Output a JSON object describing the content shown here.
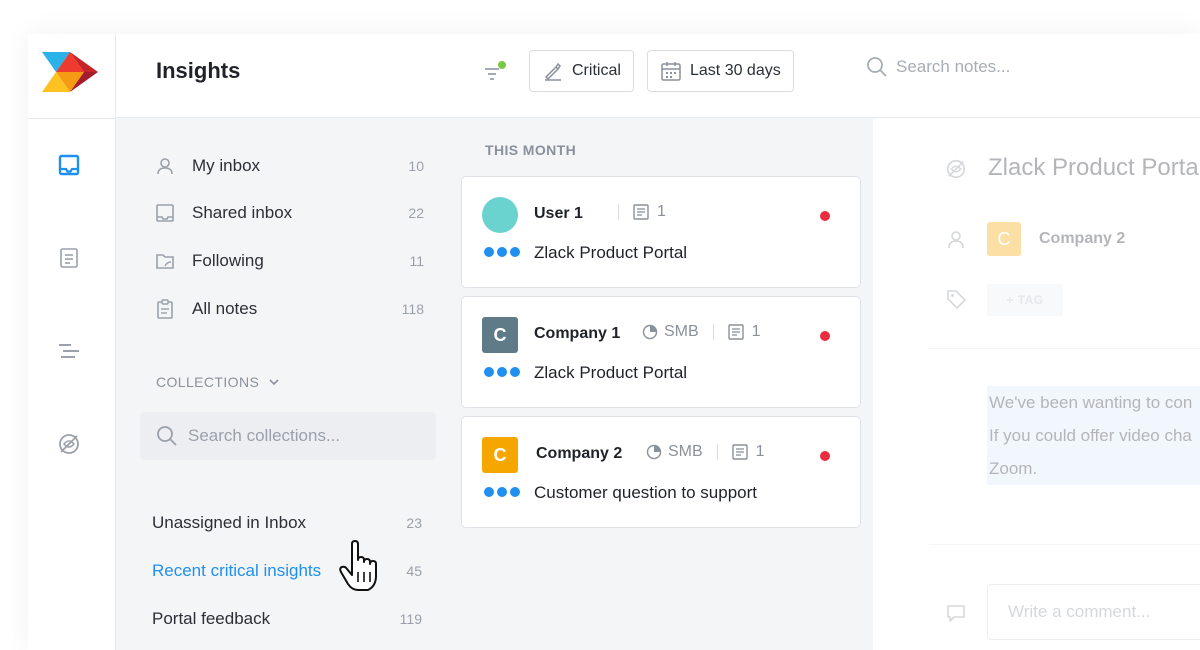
{
  "header": {
    "title": "Insights",
    "chip_critical": "Critical",
    "chip_date": "Last 30 days",
    "search_placeholder": "Search notes..."
  },
  "rail": {
    "icons": [
      "inbox-icon",
      "notes-icon",
      "roadmap-icon",
      "insights-icon"
    ],
    "active": "inbox-icon",
    "accent": "#1f8ff0"
  },
  "nav": {
    "items": [
      {
        "label": "My inbox",
        "count": "10",
        "icon": "user-icon"
      },
      {
        "label": "Shared inbox",
        "count": "22",
        "icon": "inbox-icon"
      },
      {
        "label": "Following",
        "count": "11",
        "icon": "following-icon"
      },
      {
        "label": "All notes",
        "count": "118",
        "icon": "clipboard-icon"
      }
    ],
    "collections_label": "COLLECTIONS",
    "collections_search_placeholder": "Search collections...",
    "collections": [
      {
        "label": "Unassigned in Inbox",
        "count": "23",
        "active": false
      },
      {
        "label": "Recent critical insights",
        "count": "45",
        "active": true
      },
      {
        "label": "Portal feedback",
        "count": "119",
        "active": false
      }
    ]
  },
  "list": {
    "section": "THIS MONTH",
    "cards": [
      {
        "name": "User 1",
        "avatar_letter": "",
        "avatar_color": "#6bd3cf",
        "avatar_shape": "circle",
        "segment": "",
        "notes": "1",
        "title": "Zlack Product Portal"
      },
      {
        "name": "Company 1",
        "avatar_letter": "C",
        "avatar_color": "#5f7b88",
        "avatar_shape": "square",
        "segment": "SMB",
        "notes": "1",
        "title": "Zlack Product Portal"
      },
      {
        "name": "Company 2",
        "avatar_letter": "C",
        "avatar_color": "#f5a600",
        "avatar_shape": "square",
        "segment": "SMB",
        "notes": "1",
        "title": "Customer question to support"
      }
    ],
    "colors": {
      "critical_dot": "#ea2e3e",
      "importance_dots": "#1f8ff0"
    }
  },
  "detail": {
    "title": "Zlack Product Porta",
    "company_letter": "C",
    "company_name": "Company 2",
    "tag_button": "+ TAG",
    "body_lines": [
      "We've been wanting to con",
      "If you could offer video cha",
      "Zoom."
    ],
    "comment_placeholder": "Write a comment..."
  }
}
